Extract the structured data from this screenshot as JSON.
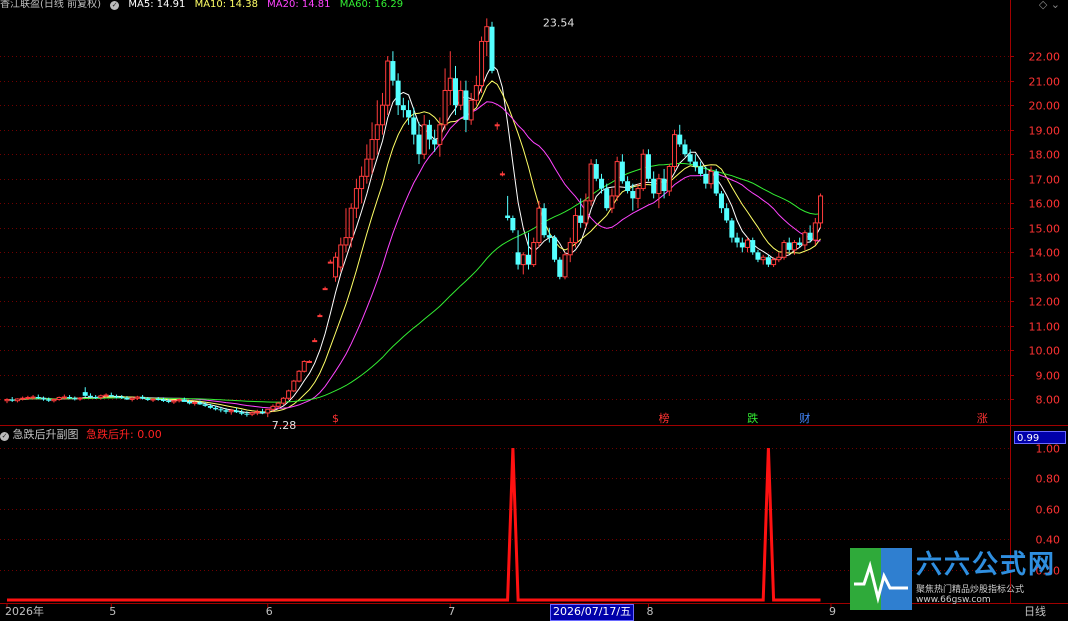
{
  "header": {
    "title": "香江联盈(日线 前复权)",
    "ma": [
      {
        "label": "MA5: 14.91",
        "color": "#ffffff"
      },
      {
        "label": "MA10: 14.38",
        "color": "#ffff66"
      },
      {
        "label": "MA20: 14.81",
        "color": "#ff44ff"
      },
      {
        "label": "MA60: 16.29",
        "color": "#33ee33"
      }
    ]
  },
  "indicator": {
    "name": "急跌后升副图",
    "value_label": "急跌后升: 0.00",
    "badge": "0.99"
  },
  "cursor_date": "2026/07/17/五",
  "period_label": "日线",
  "watermark": {
    "title": "六六公式网",
    "subtitle": "聚焦热门精品炒股指标公式",
    "url": "www.66gsw.com"
  },
  "markers": [
    {
      "text": "$",
      "color": "#ff3333",
      "i": 63
    },
    {
      "text": "榜",
      "color": "#ff3333",
      "i": 126
    },
    {
      "text": "跌",
      "color": "#33ee33",
      "i": 143
    },
    {
      "text": "财",
      "color": "#4488ff",
      "i": 153
    },
    {
      "text": "涨",
      "color": "#ff3333",
      "i": 187
    }
  ],
  "x_labels": [
    {
      "text": "2026年",
      "i": 0
    },
    {
      "text": "5",
      "i": 20
    },
    {
      "text": "6",
      "i": 50
    },
    {
      "text": "7",
      "i": 85
    },
    {
      "text": "8",
      "i": 123
    },
    {
      "text": "9",
      "i": 158
    }
  ],
  "chart_data": [
    {
      "type": "candlestick",
      "y_ticks": [
        8.0,
        9.0,
        10.0,
        11.0,
        12.0,
        13.0,
        14.0,
        15.0,
        16.0,
        17.0,
        18.0,
        19.0,
        20.0,
        21.0,
        22.0
      ],
      "ylim": [
        7.0,
        23.8
      ],
      "annotations": [
        {
          "text": "23.54",
          "i": 102,
          "value": 23.54
        },
        {
          "text": "7.28",
          "i": 50,
          "value": 7.28
        }
      ],
      "ohlc": [
        [
          7.95,
          8.05,
          7.85,
          8.0
        ],
        [
          8.0,
          8.1,
          7.9,
          7.95
        ],
        [
          7.95,
          8.05,
          7.88,
          8.02
        ],
        [
          8.02,
          8.12,
          7.96,
          8.05
        ],
        [
          8.05,
          8.15,
          7.98,
          8.08
        ],
        [
          8.08,
          8.18,
          8.0,
          8.1
        ],
        [
          8.1,
          8.2,
          8.02,
          8.05
        ],
        [
          8.05,
          8.12,
          7.95,
          8.0
        ],
        [
          8.0,
          8.08,
          7.9,
          7.95
        ],
        [
          7.95,
          8.05,
          7.88,
          8.0
        ],
        [
          8.0,
          8.12,
          7.95,
          8.08
        ],
        [
          8.08,
          8.2,
          8.0,
          8.1
        ],
        [
          8.1,
          8.18,
          8.02,
          8.05
        ],
        [
          8.05,
          8.12,
          7.96,
          8.02
        ],
        [
          8.02,
          8.1,
          7.95,
          8.06
        ],
        [
          8.3,
          8.5,
          8.1,
          8.15
        ],
        [
          8.15,
          8.25,
          8.05,
          8.1
        ],
        [
          8.1,
          8.18,
          8.02,
          8.08
        ],
        [
          8.08,
          8.2,
          8.0,
          8.15
        ],
        [
          8.15,
          8.25,
          8.08,
          8.18
        ],
        [
          8.18,
          8.28,
          8.1,
          8.12
        ],
        [
          8.12,
          8.2,
          8.04,
          8.1
        ],
        [
          8.1,
          8.18,
          8.02,
          8.06
        ],
        [
          8.06,
          8.14,
          7.98,
          8.0
        ],
        [
          8.0,
          8.1,
          7.92,
          8.05
        ],
        [
          8.05,
          8.15,
          7.98,
          8.1
        ],
        [
          8.1,
          8.18,
          8.0,
          8.04
        ],
        [
          8.04,
          8.1,
          7.94,
          7.98
        ],
        [
          7.98,
          8.05,
          7.9,
          8.02
        ],
        [
          8.02,
          8.1,
          7.95,
          8.0
        ],
        [
          8.0,
          8.08,
          7.9,
          7.94
        ],
        [
          7.94,
          8.02,
          7.85,
          7.9
        ],
        [
          7.9,
          7.98,
          7.82,
          7.95
        ],
        [
          7.95,
          8.05,
          7.88,
          8.0
        ],
        [
          8.0,
          8.08,
          7.92,
          7.9
        ],
        [
          7.9,
          7.98,
          7.8,
          7.84
        ],
        [
          7.84,
          7.92,
          7.75,
          7.88
        ],
        [
          7.88,
          7.96,
          7.78,
          7.8
        ],
        [
          7.8,
          7.9,
          7.7,
          7.74
        ],
        [
          7.74,
          7.82,
          7.62,
          7.66
        ],
        [
          7.66,
          7.75,
          7.55,
          7.6
        ],
        [
          7.6,
          7.7,
          7.48,
          7.56
        ],
        [
          7.56,
          7.65,
          7.42,
          7.5
        ],
        [
          7.5,
          7.62,
          7.38,
          7.55
        ],
        [
          7.55,
          7.66,
          7.45,
          7.48
        ],
        [
          7.48,
          7.58,
          7.36,
          7.42
        ],
        [
          7.42,
          7.52,
          7.3,
          7.4
        ],
        [
          7.4,
          7.5,
          7.32,
          7.46
        ],
        [
          7.46,
          7.58,
          7.36,
          7.5
        ],
        [
          7.5,
          7.62,
          7.4,
          7.45
        ],
        [
          7.45,
          7.55,
          7.28,
          7.6
        ],
        [
          7.6,
          7.8,
          7.5,
          7.72
        ],
        [
          7.72,
          7.9,
          7.62,
          7.85
        ],
        [
          7.85,
          8.1,
          7.78,
          8.05
        ],
        [
          8.05,
          8.4,
          7.98,
          8.35
        ],
        [
          8.35,
          8.8,
          8.3,
          8.75
        ],
        [
          8.75,
          9.2,
          8.7,
          9.15
        ],
        [
          9.15,
          9.6,
          9.1,
          9.55
        ],
        [
          9.55,
          9.6,
          9.5,
          9.55
        ],
        [
          10.4,
          10.5,
          10.38,
          10.4
        ],
        [
          11.4,
          11.5,
          11.38,
          11.42
        ],
        [
          12.5,
          12.6,
          12.48,
          12.52
        ],
        [
          13.6,
          13.7,
          13.58,
          13.6
        ],
        [
          13.0,
          14.0,
          12.8,
          13.8
        ],
        [
          13.4,
          14.6,
          13.2,
          14.3
        ],
        [
          14.3,
          15.8,
          14.0,
          14.6
        ],
        [
          14.6,
          16.0,
          14.2,
          15.8
        ],
        [
          15.8,
          17.0,
          15.4,
          16.6
        ],
        [
          16.6,
          17.5,
          16.0,
          17.1
        ],
        [
          17.1,
          18.4,
          16.8,
          17.8
        ],
        [
          17.8,
          19.3,
          17.2,
          18.6
        ],
        [
          18.6,
          20.2,
          18.0,
          19.2
        ],
        [
          19.2,
          20.5,
          18.8,
          20.0
        ],
        [
          20.0,
          22.0,
          19.6,
          21.8
        ],
        [
          21.8,
          22.2,
          20.8,
          21.0
        ],
        [
          21.0,
          21.3,
          19.6,
          20.0
        ],
        [
          20.0,
          20.3,
          19.5,
          19.8
        ],
        [
          19.8,
          20.2,
          19.2,
          19.5
        ],
        [
          19.5,
          19.9,
          18.4,
          18.8
        ],
        [
          18.8,
          19.3,
          17.6,
          18.0
        ],
        [
          18.0,
          19.6,
          17.8,
          19.2
        ],
        [
          19.2,
          19.4,
          18.2,
          18.6
        ],
        [
          18.6,
          19.0,
          18.1,
          18.4
        ],
        [
          18.4,
          19.5,
          17.9,
          19.2
        ],
        [
          19.2,
          21.5,
          19.0,
          20.6
        ],
        [
          20.6,
          22.2,
          20.0,
          21.1
        ],
        [
          21.1,
          21.6,
          19.6,
          20.0
        ],
        [
          20.0,
          21.0,
          19.8,
          20.6
        ],
        [
          20.6,
          21.0,
          18.9,
          19.4
        ],
        [
          19.4,
          20.5,
          19.2,
          20.2
        ],
        [
          20.2,
          21.2,
          20.0,
          20.8
        ],
        [
          20.8,
          22.8,
          20.5,
          22.6
        ],
        [
          22.6,
          23.54,
          22.0,
          23.2
        ],
        [
          23.2,
          23.4,
          21.3,
          21.4
        ],
        [
          19.2,
          19.3,
          19.0,
          19.2
        ],
        [
          17.2,
          17.3,
          17.1,
          17.2
        ],
        [
          15.5,
          16.3,
          15.3,
          15.4
        ],
        [
          15.4,
          15.5,
          14.8,
          14.9
        ],
        [
          14.0,
          14.9,
          13.3,
          13.5
        ],
        [
          13.5,
          14.0,
          13.1,
          13.9
        ],
        [
          13.9,
          14.8,
          13.3,
          13.5
        ],
        [
          13.5,
          14.6,
          13.4,
          14.4
        ],
        [
          14.4,
          16.1,
          14.2,
          15.8
        ],
        [
          15.8,
          16.0,
          14.6,
          14.7
        ],
        [
          14.7,
          15.0,
          14.4,
          14.6
        ],
        [
          14.6,
          14.7,
          13.6,
          13.7
        ],
        [
          13.7,
          13.8,
          12.9,
          13.0
        ],
        [
          13.0,
          14.0,
          12.9,
          13.9
        ],
        [
          13.9,
          14.6,
          13.6,
          14.4
        ],
        [
          14.4,
          15.8,
          14.2,
          15.5
        ],
        [
          15.5,
          16.2,
          15.0,
          15.2
        ],
        [
          15.2,
          16.4,
          15.0,
          16.1
        ],
        [
          16.1,
          17.8,
          15.9,
          17.6
        ],
        [
          17.6,
          17.8,
          16.9,
          17.0
        ],
        [
          17.0,
          17.2,
          16.4,
          16.6
        ],
        [
          16.6,
          16.8,
          15.7,
          15.8
        ],
        [
          15.8,
          16.6,
          15.6,
          16.3
        ],
        [
          16.3,
          17.9,
          16.1,
          17.7
        ],
        [
          17.7,
          18.0,
          16.8,
          16.9
        ],
        [
          16.9,
          17.1,
          16.4,
          16.5
        ],
        [
          16.5,
          16.8,
          15.7,
          16.2
        ],
        [
          16.2,
          16.8,
          15.8,
          16.6
        ],
        [
          16.6,
          18.2,
          16.5,
          18.0
        ],
        [
          18.0,
          18.2,
          16.9,
          17.0
        ],
        [
          17.0,
          17.3,
          16.2,
          16.4
        ],
        [
          16.4,
          17.2,
          15.8,
          17.0
        ],
        [
          17.0,
          17.4,
          16.2,
          16.5
        ],
        [
          16.5,
          17.6,
          16.3,
          17.5
        ],
        [
          17.5,
          19.0,
          17.3,
          18.8
        ],
        [
          18.8,
          19.2,
          18.3,
          18.4
        ],
        [
          18.4,
          18.6,
          17.9,
          18.0
        ],
        [
          18.0,
          18.2,
          17.6,
          17.7
        ],
        [
          17.7,
          18.0,
          17.3,
          17.5
        ],
        [
          17.5,
          17.7,
          17.1,
          17.2
        ],
        [
          17.2,
          17.5,
          16.6,
          16.8
        ],
        [
          16.8,
          17.5,
          16.6,
          17.3
        ],
        [
          17.3,
          17.4,
          16.3,
          16.4
        ],
        [
          16.4,
          16.5,
          15.6,
          15.8
        ],
        [
          15.8,
          16.0,
          15.2,
          15.3
        ],
        [
          15.3,
          15.4,
          14.4,
          14.6
        ],
        [
          14.6,
          14.8,
          14.2,
          14.4
        ],
        [
          14.4,
          14.6,
          14.0,
          14.2
        ],
        [
          14.2,
          14.6,
          14.0,
          14.5
        ],
        [
          14.5,
          14.6,
          13.9,
          14.0
        ],
        [
          14.0,
          14.1,
          13.6,
          13.7
        ],
        [
          13.7,
          13.9,
          13.5,
          13.8
        ],
        [
          13.8,
          13.9,
          13.4,
          13.5
        ],
        [
          13.5,
          13.8,
          13.4,
          13.7
        ],
        [
          13.7,
          14.0,
          13.6,
          13.8
        ],
        [
          13.8,
          14.5,
          13.7,
          14.4
        ],
        [
          14.4,
          14.6,
          14.0,
          14.1
        ],
        [
          14.1,
          14.5,
          13.9,
          14.4
        ],
        [
          14.4,
          14.6,
          14.2,
          14.3
        ],
        [
          14.3,
          14.9,
          14.1,
          14.8
        ],
        [
          14.8,
          15.1,
          14.4,
          14.5
        ],
        [
          14.5,
          15.4,
          14.3,
          15.2
        ],
        [
          15.2,
          16.4,
          15.0,
          16.3
        ]
      ],
      "ma_series": [
        {
          "name": "MA5",
          "color": "#ffffff",
          "period": 5
        },
        {
          "name": "MA10",
          "color": "#ffff66",
          "period": 10
        },
        {
          "name": "MA20",
          "color": "#ff44ff",
          "period": 20
        },
        {
          "name": "MA60",
          "color": "#33ee33",
          "period": 60
        }
      ]
    },
    {
      "type": "line",
      "name": "急跌后升",
      "color": "#ff1111",
      "y_ticks": [
        0.2,
        0.4,
        0.6,
        0.8,
        1.0
      ],
      "ylim": [
        0,
        1.0
      ],
      "spikes": [
        {
          "i": 97,
          "value": 1.0
        },
        {
          "i": 146,
          "value": 1.0
        }
      ],
      "baseline": 0
    }
  ]
}
